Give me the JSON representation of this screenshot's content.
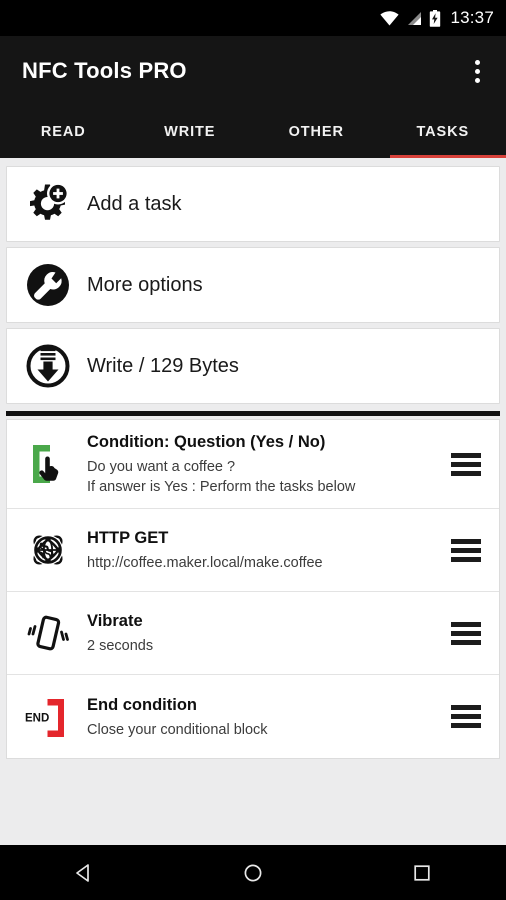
{
  "status_bar": {
    "time": "13:37",
    "icons": [
      "wifi-icon",
      "cellular-signal-icon",
      "battery-charging-icon"
    ]
  },
  "app_bar": {
    "title": "NFC Tools PRO",
    "overflow_menu": "overflow-menu-icon"
  },
  "tabs": {
    "items": [
      {
        "label": "READ",
        "active": false
      },
      {
        "label": "WRITE",
        "active": false
      },
      {
        "label": "OTHER",
        "active": false
      },
      {
        "label": "TASKS",
        "active": true
      }
    ],
    "indicator_color": "#d8413a"
  },
  "action_cards": [
    {
      "label": "Add a task",
      "icon": "gear-plus-icon"
    },
    {
      "label": "More options",
      "icon": "wrench-circle-icon"
    },
    {
      "label": "Write / 129 Bytes",
      "icon": "write-download-icon"
    }
  ],
  "tasks": [
    {
      "title": "Condition: Question (Yes / No)",
      "subtitle": "Do you want a coffee ?\nIf answer is Yes : Perform the tasks below",
      "icon": "condition-bracket-cursor-icon",
      "icon_color": "#4aa84a",
      "handle": "drag-handle-icon"
    },
    {
      "title": "HTTP GET",
      "subtitle": "http://coffee.maker.local/make.coffee",
      "icon": "globe-orbit-icon",
      "icon_color": "#111111",
      "handle": "drag-handle-icon"
    },
    {
      "title": "Vibrate",
      "subtitle": "2 seconds",
      "icon": "vibrate-phone-icon",
      "icon_color": "#111111",
      "handle": "drag-handle-icon"
    },
    {
      "title": "End condition",
      "subtitle": "Close your conditional block",
      "icon": "end-bracket-icon",
      "icon_color": "#e4262c",
      "handle": "drag-handle-icon"
    }
  ],
  "nav_bar": {
    "back": "back-triangle-icon",
    "home": "home-circle-icon",
    "recents": "recents-square-icon"
  },
  "colors": {
    "accent_red": "#d8413a",
    "background": "#ececed",
    "card": "#ffffff",
    "appbar": "#151515"
  }
}
